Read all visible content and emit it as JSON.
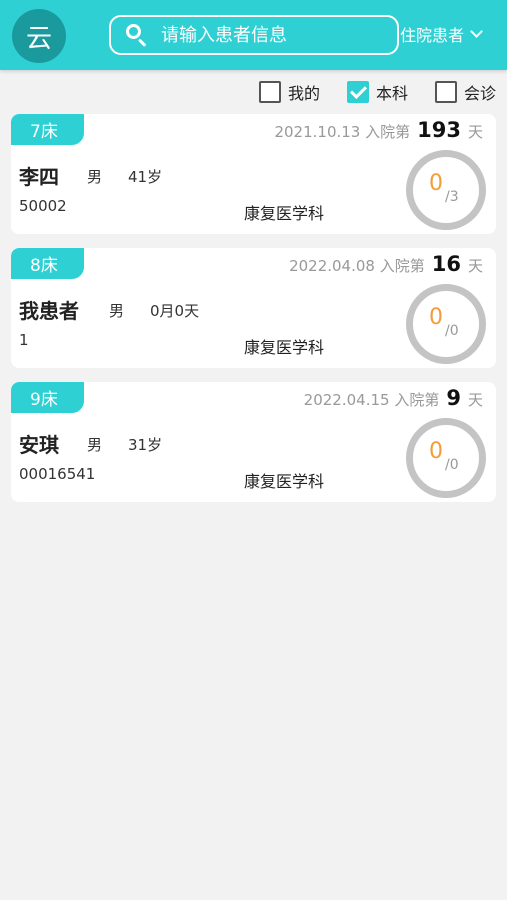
{
  "header": {
    "logo_text": "云",
    "search_placeholder": "请输入患者信息",
    "dropdown_label": "住院患者"
  },
  "filters": [
    {
      "label": "我的",
      "checked": false
    },
    {
      "label": "本科",
      "checked": true
    },
    {
      "label": "会诊",
      "checked": false
    }
  ],
  "admission_prefix": "入院第",
  "admission_suffix": "天",
  "patients": [
    {
      "bed": "7床",
      "date": "2021.10.13",
      "days": "193",
      "name": "李四",
      "sex": "男",
      "age": "41岁",
      "id": "50002",
      "dept": "康复医学科",
      "done": "0",
      "total": "/3"
    },
    {
      "bed": "8床",
      "date": "2022.04.08",
      "days": "16",
      "name": "我患者",
      "sex": "男",
      "age": "0月0天",
      "id": "1",
      "dept": "康复医学科",
      "done": "0",
      "total": "/0"
    },
    {
      "bed": "9床",
      "date": "2022.04.15",
      "days": "9",
      "name": "安琪",
      "sex": "男",
      "age": "31岁",
      "id": "00016541",
      "dept": "康复医学科",
      "done": "0",
      "total": "/0"
    }
  ],
  "colors": {
    "accent": "#2fd0d3",
    "logo_bg": "#1a9a9d",
    "progress": "#f39c3a"
  }
}
